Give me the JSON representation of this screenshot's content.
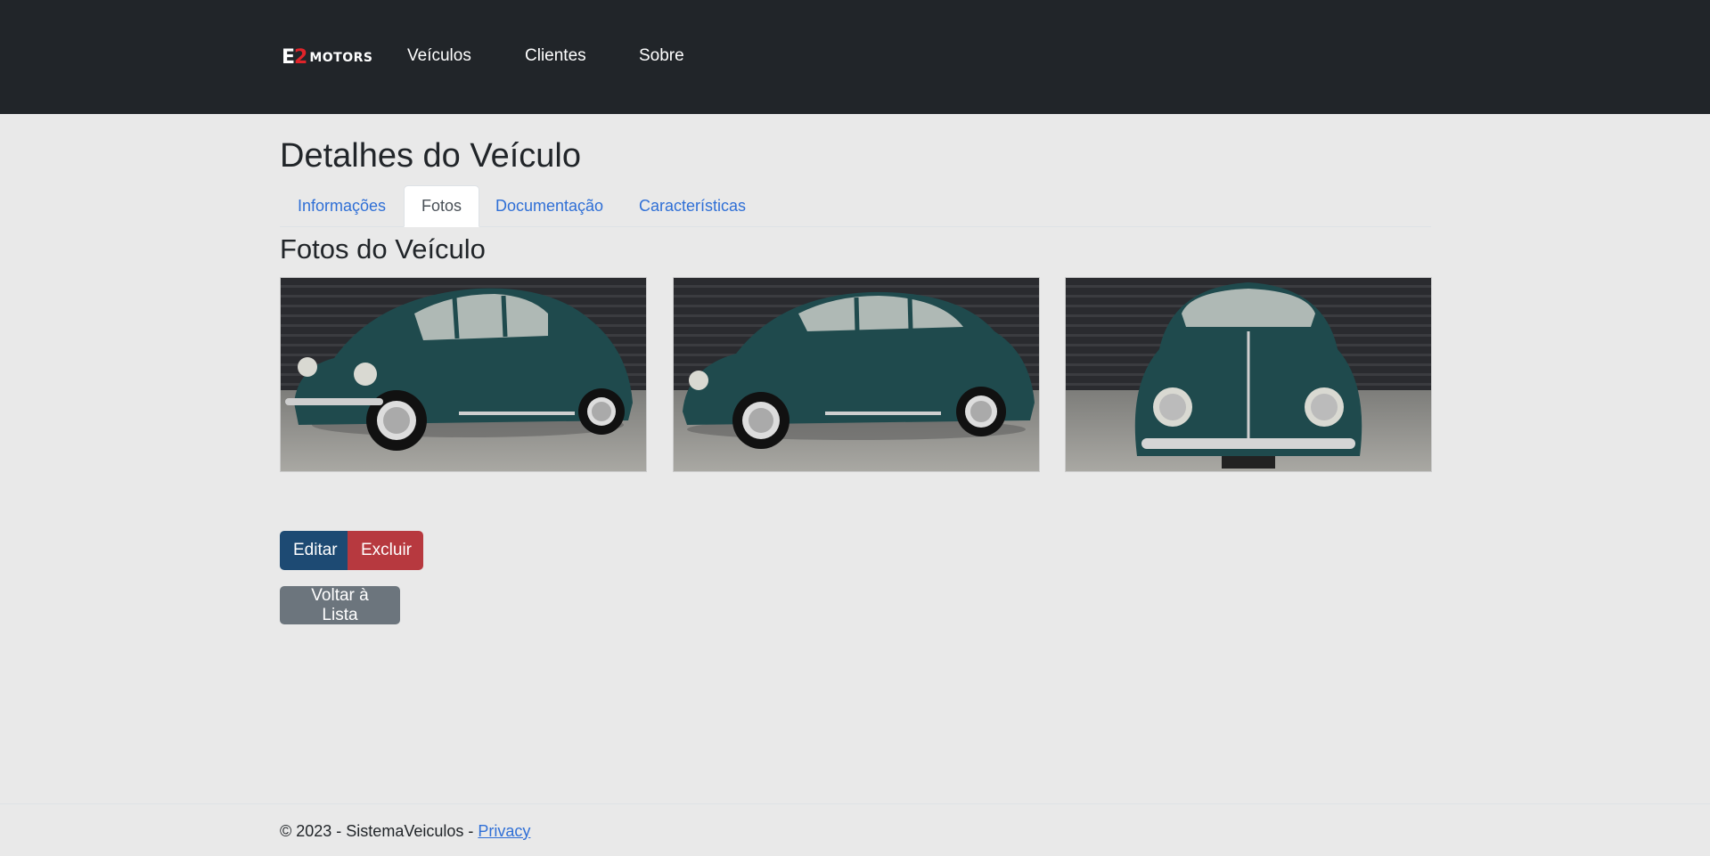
{
  "header": {
    "brand": {
      "letter": "E",
      "number": "2",
      "word": "MOTORS"
    },
    "nav": [
      {
        "label": "Veículos"
      },
      {
        "label": "Clientes"
      },
      {
        "label": "Sobre"
      }
    ]
  },
  "page": {
    "title": "Detalhes do Veículo",
    "tabs": [
      {
        "label": "Informações",
        "active": false
      },
      {
        "label": "Fotos",
        "active": true
      },
      {
        "label": "Documentação",
        "active": false
      },
      {
        "label": "Características",
        "active": false
      }
    ],
    "section_title": "Fotos do Veículo",
    "photos": [
      {
        "subject": "car-front-three-quarter",
        "color": "#1f4a4d"
      },
      {
        "subject": "car-side",
        "color": "#1f4a4d"
      },
      {
        "subject": "car-front",
        "color": "#1f4a4d"
      }
    ],
    "buttons": {
      "edit": "Editar",
      "delete": "Excluir",
      "back": "Voltar à Lista"
    }
  },
  "footer": {
    "text": "© 2023 - SistemaVeiculos - ",
    "link": "Privacy"
  },
  "colors": {
    "navbar": "#212529",
    "background": "#e9e9e9",
    "link": "#2f6fd6",
    "edit_button": "#1d4a73",
    "delete_button": "#b7393f",
    "back_button": "#6c757d"
  }
}
